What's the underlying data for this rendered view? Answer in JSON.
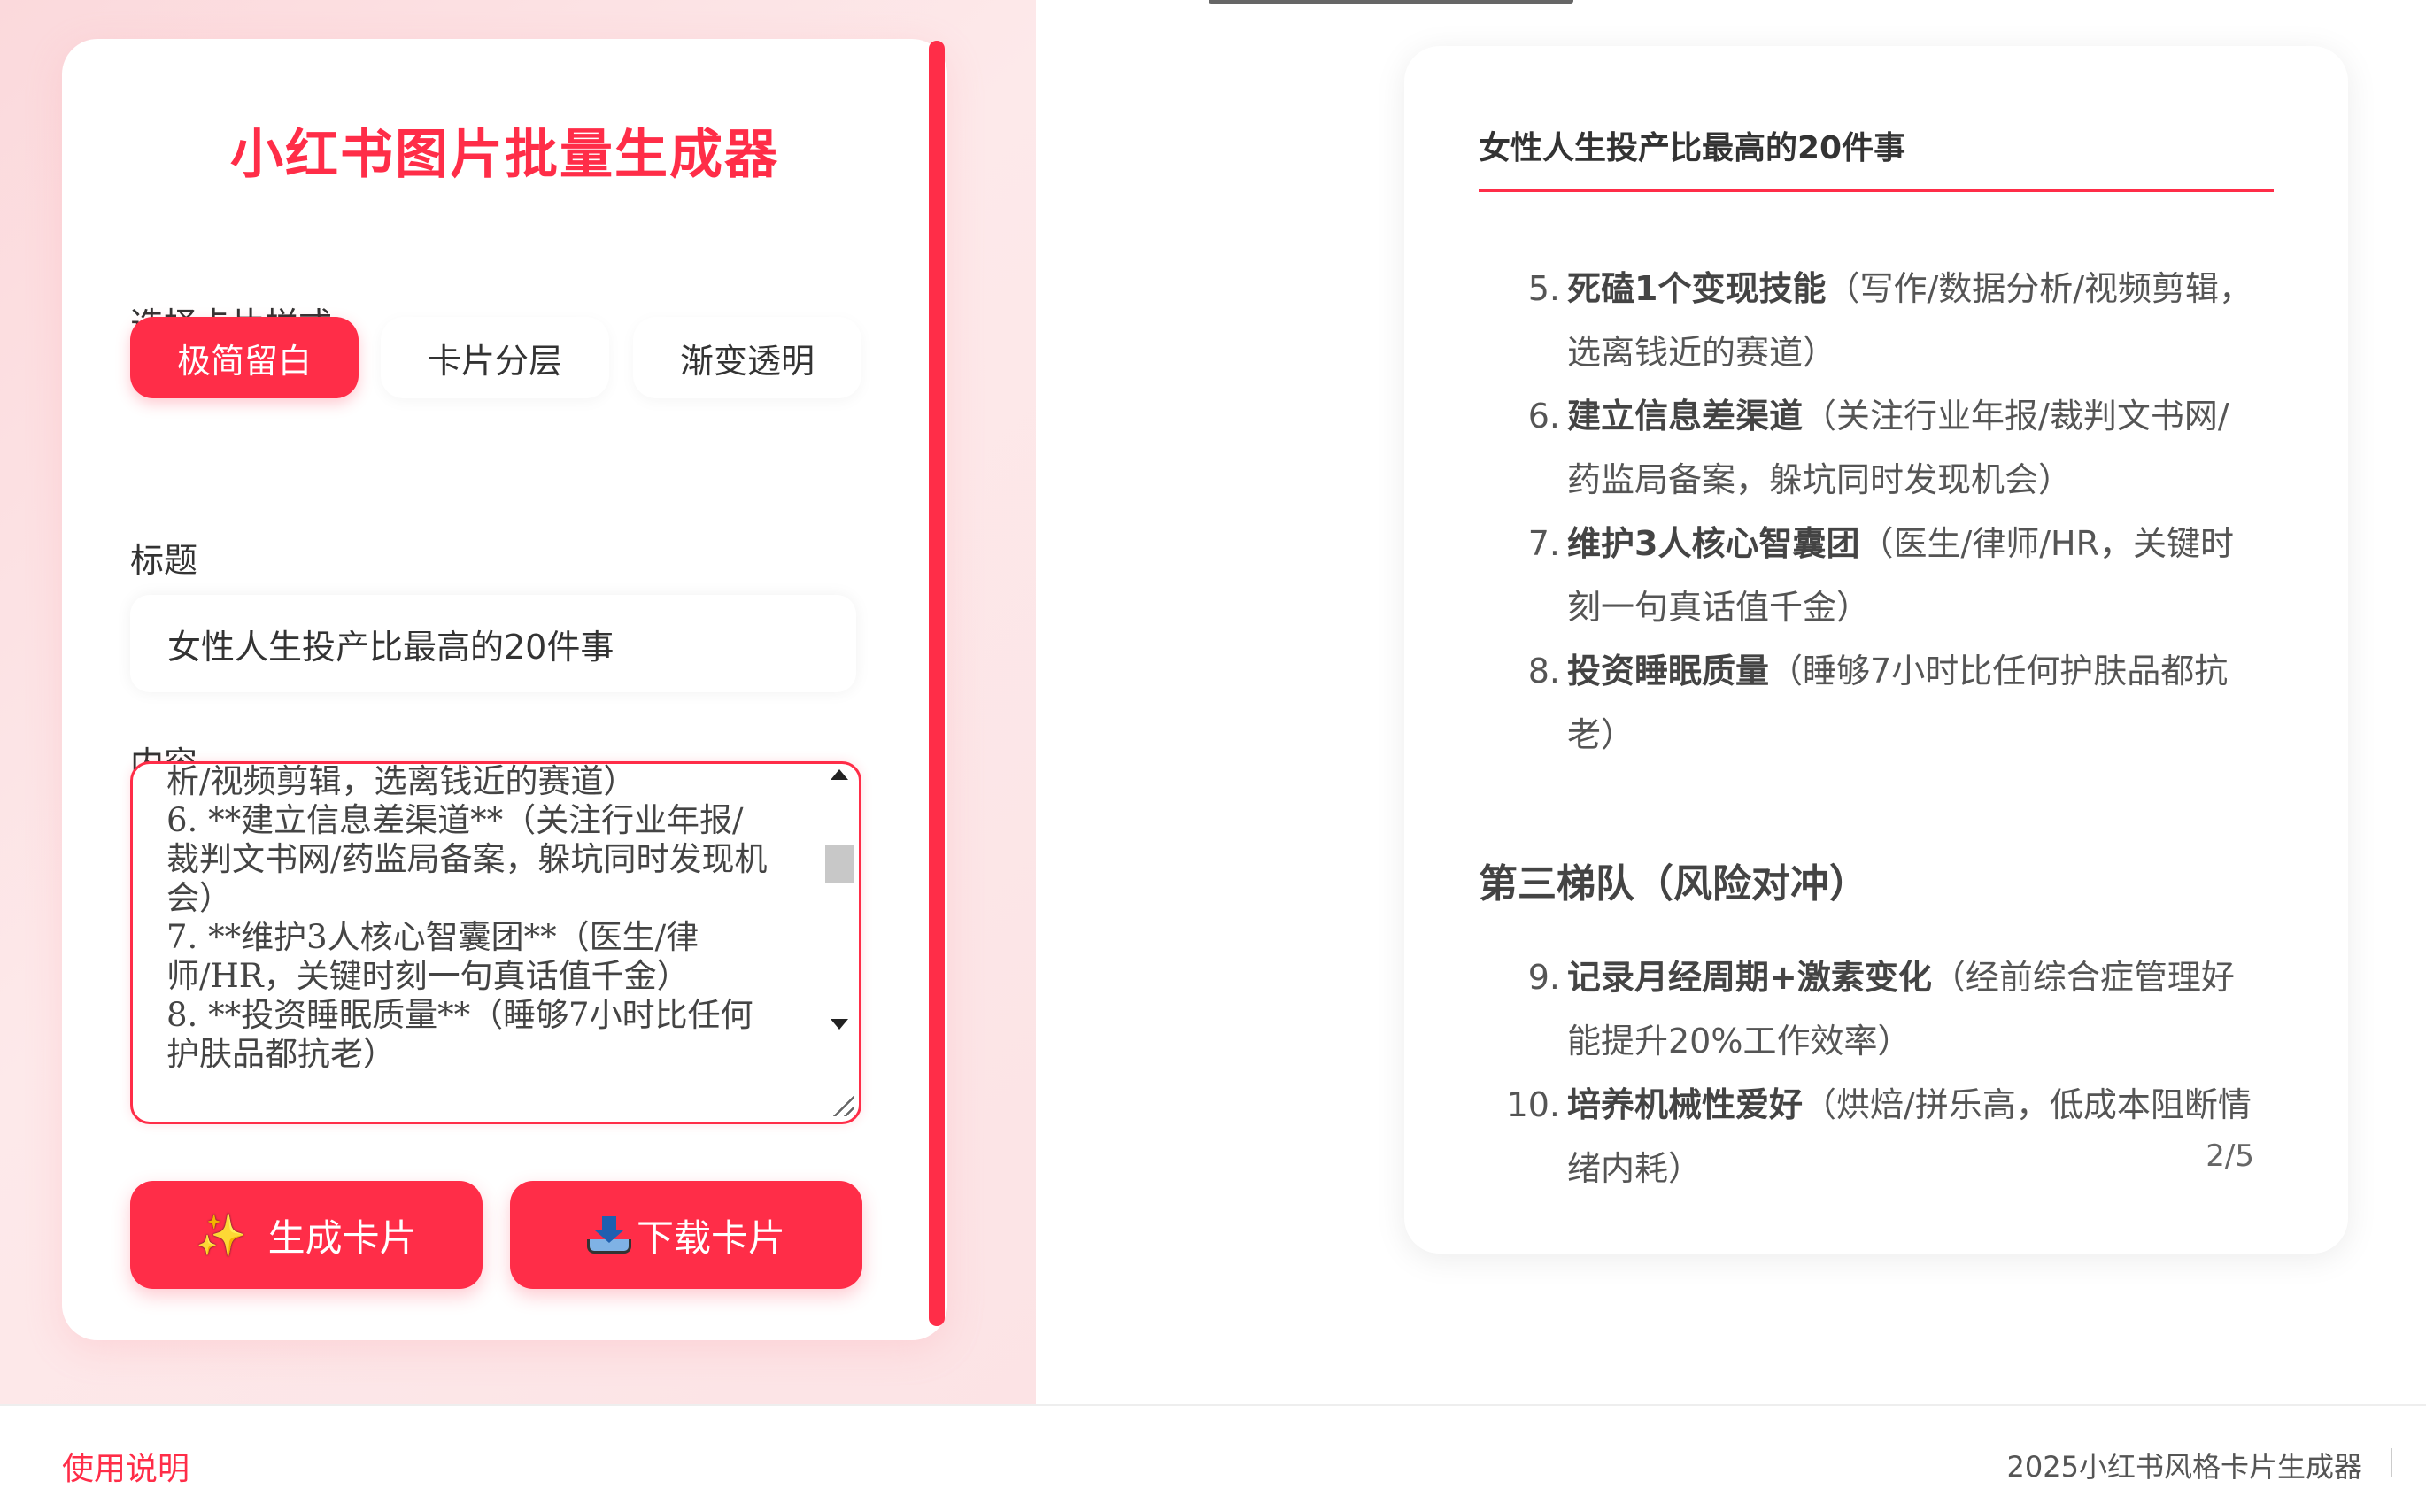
{
  "app": {
    "title": "小红书图片批量生成器"
  },
  "colors": {
    "accent": "#ff2d48",
    "panel_bg": "#ffffff",
    "page_bg_left": "#fbd9dc"
  },
  "editor": {
    "style_label": "选择卡片样式",
    "styles": [
      {
        "label": "极简留白",
        "active": true
      },
      {
        "label": "卡片分层",
        "active": false
      },
      {
        "label": "渐变透明",
        "active": false
      }
    ],
    "title_label": "标题",
    "title_value": "女性人生投产比最高的20件事",
    "content_label": "内容",
    "content_value": "析/视频剪辑，选离钱近的赛道）\n6. **建立信息差渠道**（关注行业年报/\n裁判文书网/药监局备案，躲坑同时发现机\n会）\n7. **维护3人核心智囊团**（医生/律\n师/HR，关键时刻一句真话值千金）\n8. **投资睡眠质量**（睡够7小时比任何\n护肤品都抗老）",
    "generate_button": "生成卡片",
    "generate_icon": "sparkles-icon",
    "download_button": "下载卡片",
    "download_icon": "inbox-tray-icon"
  },
  "preview": {
    "title": "女性人生投产比最高的20件事",
    "items": [
      {
        "num": "5.",
        "bold": "死磕1个变现技能",
        "text": "（写作/数据分析/视频剪辑，选离钱近的赛道）"
      },
      {
        "num": "6.",
        "bold": "建立信息差渠道",
        "text": "（关注行业年报/裁判文书网/药监局备案，躲坑同时发现机会）"
      },
      {
        "num": "7.",
        "bold": "维护3人核心智囊团",
        "text": "（医生/律师/HR，关键时刻一句真话值千金）"
      },
      {
        "num": "8.",
        "bold": "投资睡眠质量",
        "text": "（睡够7小时比任何护肤品都抗老）"
      }
    ],
    "section_heading": "第三梯队（风险对冲）",
    "items2": [
      {
        "num": "9.",
        "bold": "记录月经周期+激素变化",
        "text": "（经前综合症管理好能提升20%工作效率）"
      },
      {
        "num": "10.",
        "bold": "培养机械性爱好",
        "text": "（烘焙/拼乐高，低成本阻断情绪内耗）"
      }
    ],
    "page_indicator": "2/5"
  },
  "footer": {
    "help_link": "使用说明",
    "copyright": "2025小红书风格卡片生成器"
  }
}
